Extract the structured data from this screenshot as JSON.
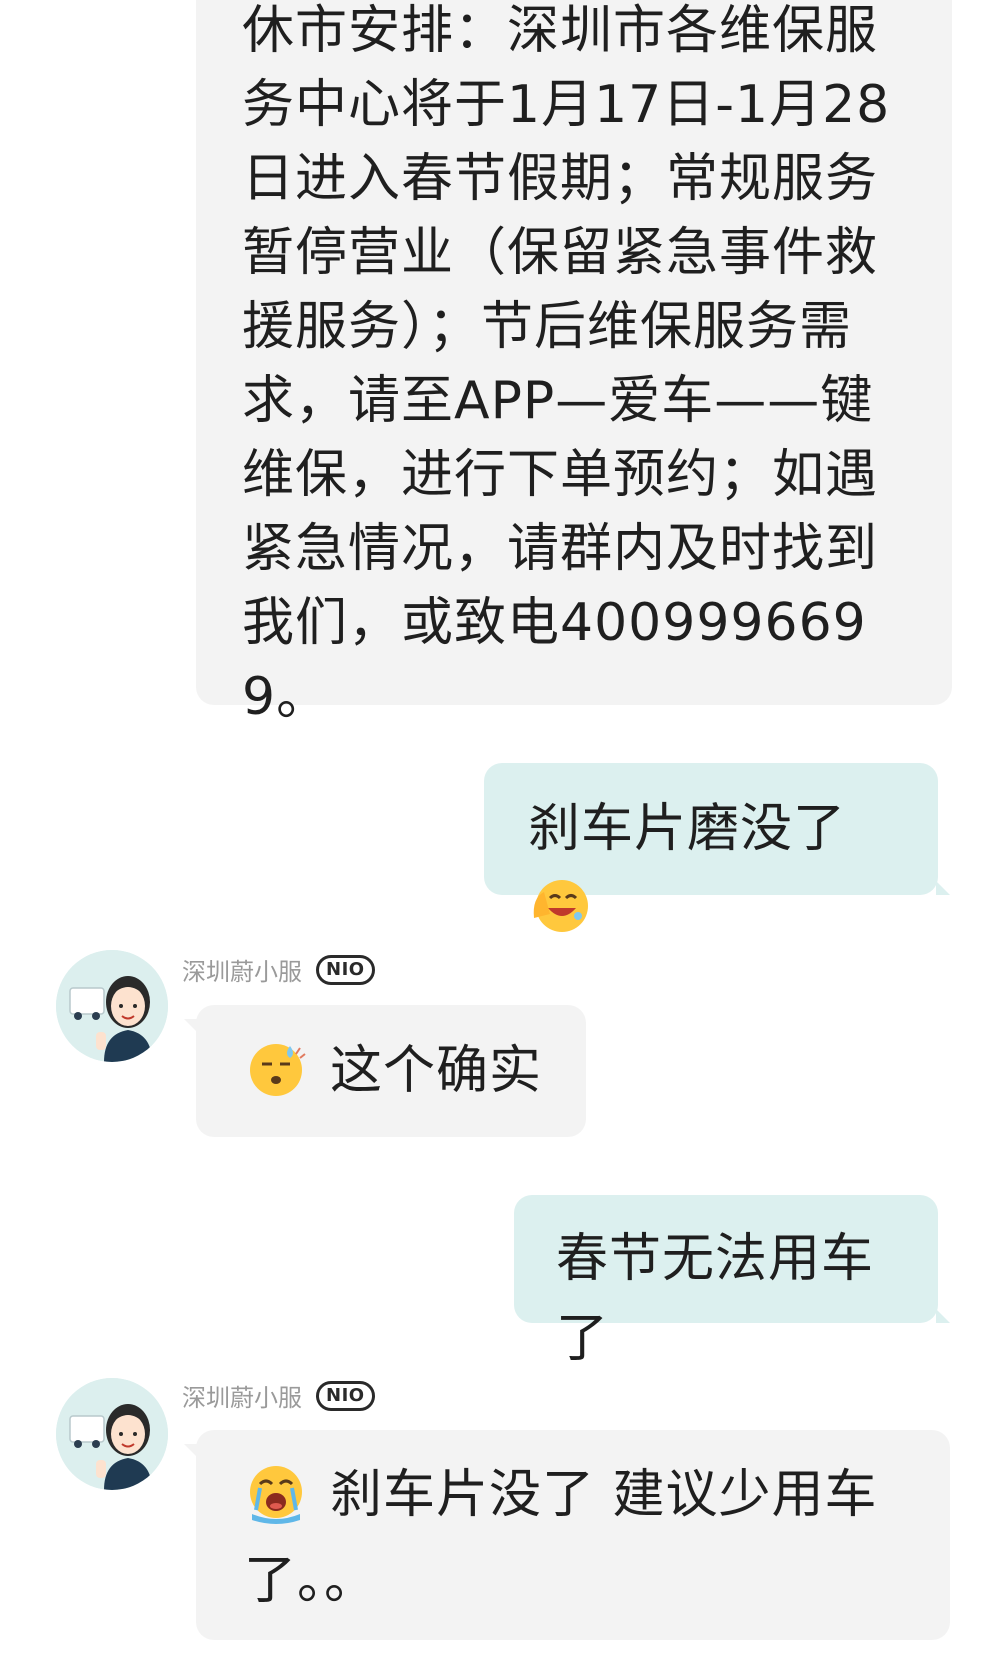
{
  "messages": [
    {
      "id": "notice",
      "direction": "incoming",
      "text": "休市安排：深圳市各维保服务中心将于1月17日-1月28日进入春节假期；常规服务暂停营业（保留紧急事件救援服务）；节后维保服务需求，请至APP—爱车——键维保，进行下单预约；如遇紧急情况，请群内及时找到我们，或致电4009996699。"
    },
    {
      "id": "brake",
      "direction": "outgoing",
      "text": "刹车片磨没了",
      "emoji": "face-palm-laughing"
    },
    {
      "id": "reply1",
      "direction": "incoming",
      "sender": "深圳蔚小服",
      "badge": "NIO",
      "emoji": "sweat-face",
      "text": "这个确实"
    },
    {
      "id": "spring",
      "direction": "outgoing",
      "text": "春节无法用车了"
    },
    {
      "id": "reply2",
      "direction": "incoming",
      "sender": "深圳蔚小服",
      "badge": "NIO",
      "emoji": "crying-face",
      "text": "刹车片没了 建议少用车了。。"
    }
  ],
  "colors": {
    "incoming_bubble": "#f3f3f3",
    "outgoing_bubble": "#dcf0ef",
    "sender_name": "#9a9a9a",
    "text": "#1f1f1f"
  }
}
